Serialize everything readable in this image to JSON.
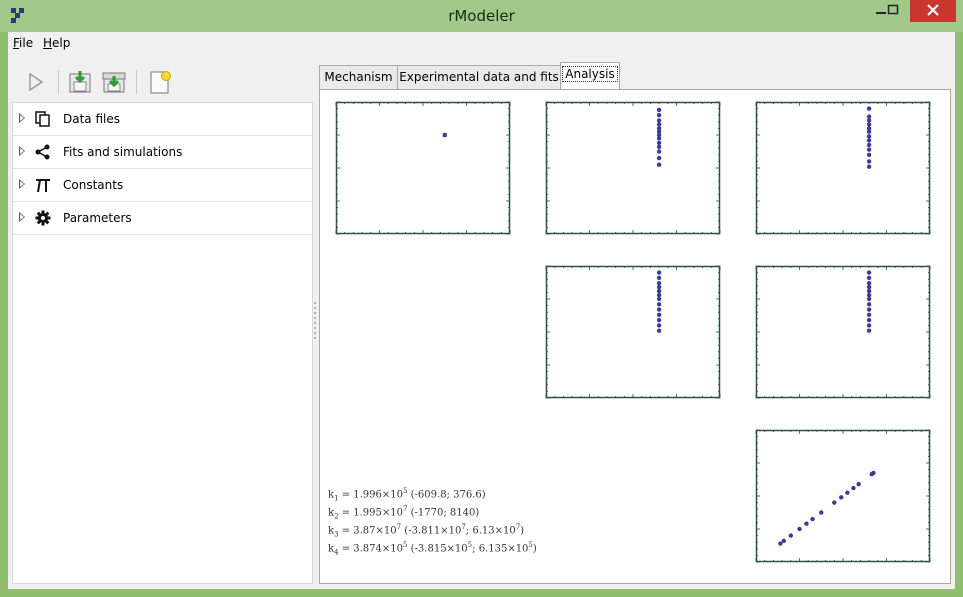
{
  "window": {
    "title": "rModeler"
  },
  "menu": {
    "file": "File",
    "file_mnemonic": "F",
    "file_rest": "ile",
    "help": "Help",
    "help_mnemonic": "H",
    "help_rest": "elp"
  },
  "toolbar": {
    "icons": [
      "play-icon",
      "import-icon",
      "export-icon",
      "new-document-icon"
    ]
  },
  "tree": {
    "items": [
      {
        "label": "Data files",
        "icon": "copy-files-icon"
      },
      {
        "label": "Fits and simulations",
        "icon": "share-nodes-icon"
      },
      {
        "label": "Constants",
        "icon": "pi-icon"
      },
      {
        "label": "Parameters",
        "icon": "gear-icon"
      }
    ]
  },
  "tabs": [
    {
      "label": "Mechanism",
      "active": false
    },
    {
      "label": "Experimental data and fits",
      "active": false
    },
    {
      "label": "Analysis",
      "active": true
    }
  ],
  "analysis": {
    "equations": [
      {
        "k": "k",
        "sub": "1",
        "eq": " = 1.996×10",
        "sup": "5",
        "rest": " (-609.8; 376.6)"
      },
      {
        "k": "k",
        "sub": "2",
        "eq": " = 1.995×10",
        "sup": "7",
        "rest": " (-1770; 8140)"
      },
      {
        "k": "k",
        "sub": "3",
        "eq": " = 3.87×10",
        "sup": "7",
        "rest": " (-3.811×10",
        "sup2": "7",
        "rest2": "; 6.13×10",
        "sup3": "7",
        "rest3": ")"
      },
      {
        "k": "k",
        "sub": "4",
        "eq": " = 3.874×10",
        "sup": "5",
        "rest": " (-3.815×10",
        "sup2": "5",
        "rest2": "; 6.135×10",
        "sup3": "5",
        "rest3": ")"
      }
    ]
  },
  "colors": {
    "titlebar": "#a3c98a",
    "frame": "#90be6d",
    "close": "#c7372f",
    "plot_axis": "#2f4f4f",
    "point": "#3c3c96"
  },
  "chart_data": [
    {
      "type": "scatter",
      "row": 0,
      "col": 0,
      "x": [
        0.25
      ],
      "y": [
        0.5
      ],
      "xlim": [
        -1,
        1
      ],
      "ylim": [
        -1,
        1
      ]
    },
    {
      "type": "scatter",
      "row": 0,
      "col": 1,
      "x": [
        0.3,
        0.3,
        0.3,
        0.3,
        0.3,
        0.3,
        0.3,
        0.3,
        0.3,
        0.3,
        0.3,
        0.3,
        0.3
      ],
      "y": [
        0.05,
        0.15,
        0.25,
        0.32,
        0.38,
        0.45,
        0.5,
        0.55,
        0.6,
        0.66,
        0.72,
        0.8,
        0.88
      ],
      "xlim": [
        -1,
        1
      ],
      "ylim": [
        -1,
        1
      ]
    },
    {
      "type": "scatter",
      "row": 0,
      "col": 2,
      "x": [
        0.3,
        0.3,
        0.3,
        0.3,
        0.3,
        0.3,
        0.3,
        0.3,
        0.3,
        0.3,
        0.3,
        0.3,
        0.3
      ],
      "y": [
        0.02,
        0.1,
        0.2,
        0.28,
        0.35,
        0.42,
        0.48,
        0.55,
        0.6,
        0.66,
        0.72,
        0.78,
        0.9
      ],
      "xlim": [
        -1,
        1
      ],
      "ylim": [
        -1,
        1
      ]
    },
    {
      "type": "scatter",
      "row": 1,
      "col": 1,
      "x": [
        0.3,
        0.3,
        0.3,
        0.3,
        0.3,
        0.3,
        0.3,
        0.3,
        0.3,
        0.3,
        0.3,
        0.3,
        0.3
      ],
      "y": [
        0.02,
        0.1,
        0.18,
        0.26,
        0.34,
        0.42,
        0.5,
        0.56,
        0.62,
        0.68,
        0.74,
        0.82,
        0.9
      ],
      "xlim": [
        -1,
        1
      ],
      "ylim": [
        -1,
        1
      ]
    },
    {
      "type": "scatter",
      "row": 1,
      "col": 2,
      "x": [
        0.3,
        0.3,
        0.3,
        0.3,
        0.3,
        0.3,
        0.3,
        0.3,
        0.3,
        0.3,
        0.3,
        0.3,
        0.3
      ],
      "y": [
        0.02,
        0.1,
        0.18,
        0.26,
        0.34,
        0.42,
        0.5,
        0.56,
        0.62,
        0.68,
        0.74,
        0.82,
        0.9
      ],
      "xlim": [
        -1,
        1
      ],
      "ylim": [
        -1,
        1
      ]
    },
    {
      "type": "scatter",
      "row": 2,
      "col": 2,
      "x": [
        -0.72,
        -0.68,
        -0.6,
        -0.5,
        -0.42,
        -0.35,
        -0.25,
        -0.1,
        -0.02,
        0.05,
        0.12,
        0.18,
        0.33,
        0.35
      ],
      "y": [
        -0.72,
        -0.68,
        -0.6,
        -0.5,
        -0.42,
        -0.35,
        -0.25,
        -0.1,
        -0.02,
        0.05,
        0.12,
        0.18,
        0.33,
        0.35
      ],
      "xlim": [
        -1,
        1
      ],
      "ylim": [
        -1,
        1
      ]
    }
  ]
}
